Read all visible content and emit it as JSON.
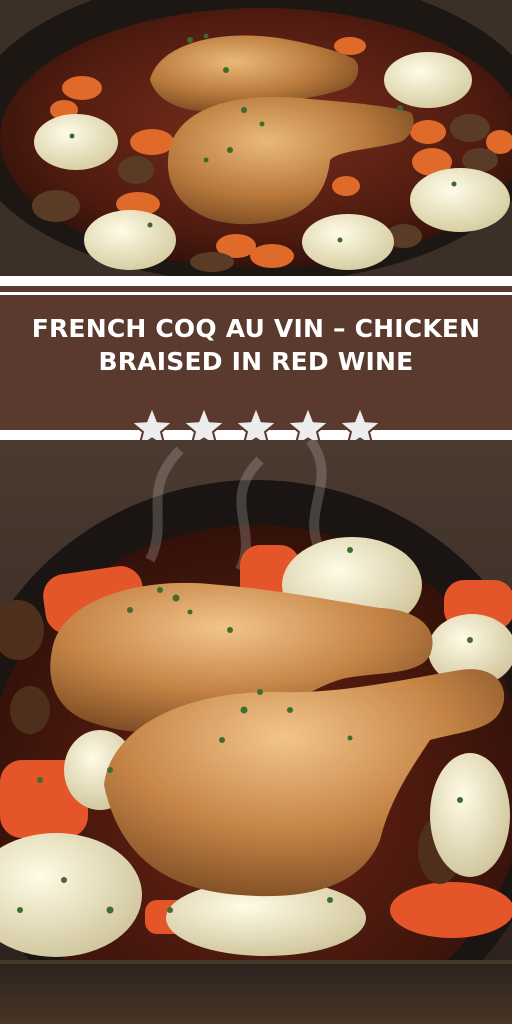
{
  "title": "FRENCH COQ AU VIN – CHICKEN BRAISED IN RED WINE",
  "rating": {
    "value": 5,
    "max": 5
  },
  "colors": {
    "band": "#5a3a2e",
    "title_text": "#ffffff",
    "star_fill": "#ececec",
    "star_stroke": "#5a3a2e"
  },
  "images": [
    {
      "name": "top-photo",
      "subject": "coq au vin in a dark skillet, overhead"
    },
    {
      "name": "bottom-photo",
      "subject": "coq au vin close-up with steam"
    }
  ]
}
